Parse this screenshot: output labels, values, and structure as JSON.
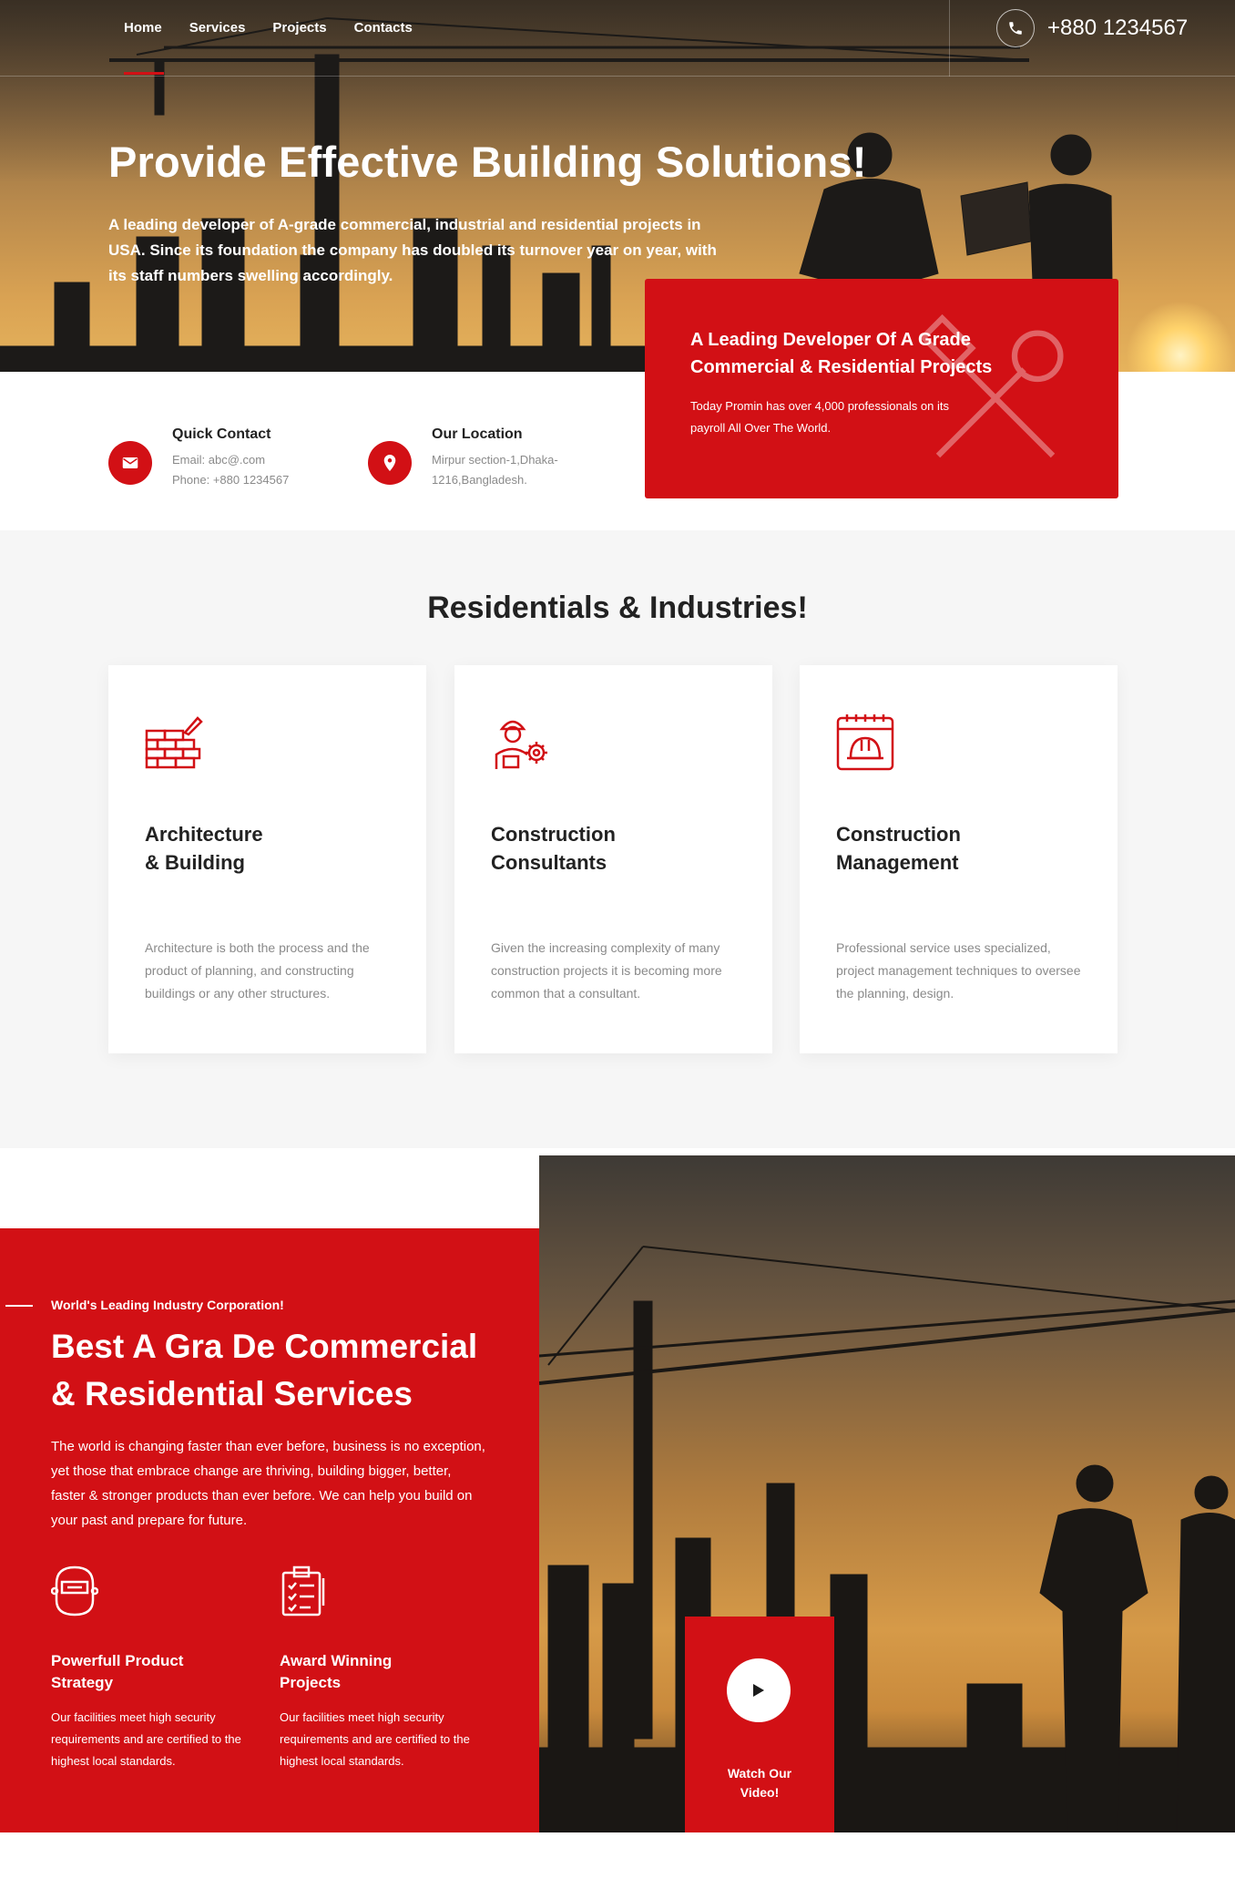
{
  "nav": {
    "items": [
      {
        "label": "Home"
      },
      {
        "label": "Services"
      },
      {
        "label": "Projects"
      },
      {
        "label": "Contacts"
      }
    ],
    "phone": "+880 1234567"
  },
  "hero": {
    "title": "Provide Effective Building Solutions!",
    "lead": "A leading developer of A-grade commercial, industrial and residential projects in USA. Since its foundation the company has doubled its turnover year on year, with its staff numbers swelling accordingly."
  },
  "contact": {
    "quick_title": "Quick Contact",
    "email": "Email: abc@.com",
    "phone": "Phone: +880 1234567",
    "location_title": "Our Location",
    "location_line1": "Mirpur section-1,Dhaka-",
    "location_line2": "1216,Bangladesh."
  },
  "highlight": {
    "title": "A Leading Developer Of A Grade Commercial & Residential Projects",
    "text": "Today Promin has over 4,000 professionals on its payroll All Over The World."
  },
  "services": {
    "heading": "Residentials & Industries!",
    "cards": [
      {
        "icon": "brick-wall-icon",
        "title_line1": "Architecture",
        "title_line2": "& Building",
        "text": "Architecture is both the process and the product of planning, and constructing buildings or any other structures."
      },
      {
        "icon": "engineer-gear-icon",
        "title_line1": "Construction",
        "title_line2": "Consultants",
        "text": "Given the increasing complexity of many construction projects it is becoming more common that a consultant."
      },
      {
        "icon": "calendar-helmet-icon",
        "title_line1": "Construction",
        "title_line2": "Management",
        "text": "Professional service uses specialized, project management techniques to oversee the planning, design."
      }
    ]
  },
  "about": {
    "tagline": "World's Leading Industry Corporation!",
    "heading_line1": "Best A Gra De Commercial",
    "heading_line2": "& Residential Services",
    "body": "The world is changing faster than ever before, business is no exception, yet those that embrace change are thriving, building bigger, better, faster & stronger products than ever before. We can help you build on your past and prepare for future.",
    "features": [
      {
        "icon": "welding-mask-icon",
        "title_line1": "Powerfull Product",
        "title_line2": "Strategy",
        "text": "Our facilities meet high security requirements and are certified to the highest local standards."
      },
      {
        "icon": "clipboard-checklist-icon",
        "title_line1": "Award Winning",
        "title_line2": "Projects",
        "text": "Our facilities meet high security requirements and are certified to the highest local standards."
      }
    ],
    "video_line1": "Watch Our",
    "video_line2": "Video!"
  },
  "colors": {
    "accent": "#d21015",
    "text": "#222222",
    "muted": "#8a8a8a"
  }
}
